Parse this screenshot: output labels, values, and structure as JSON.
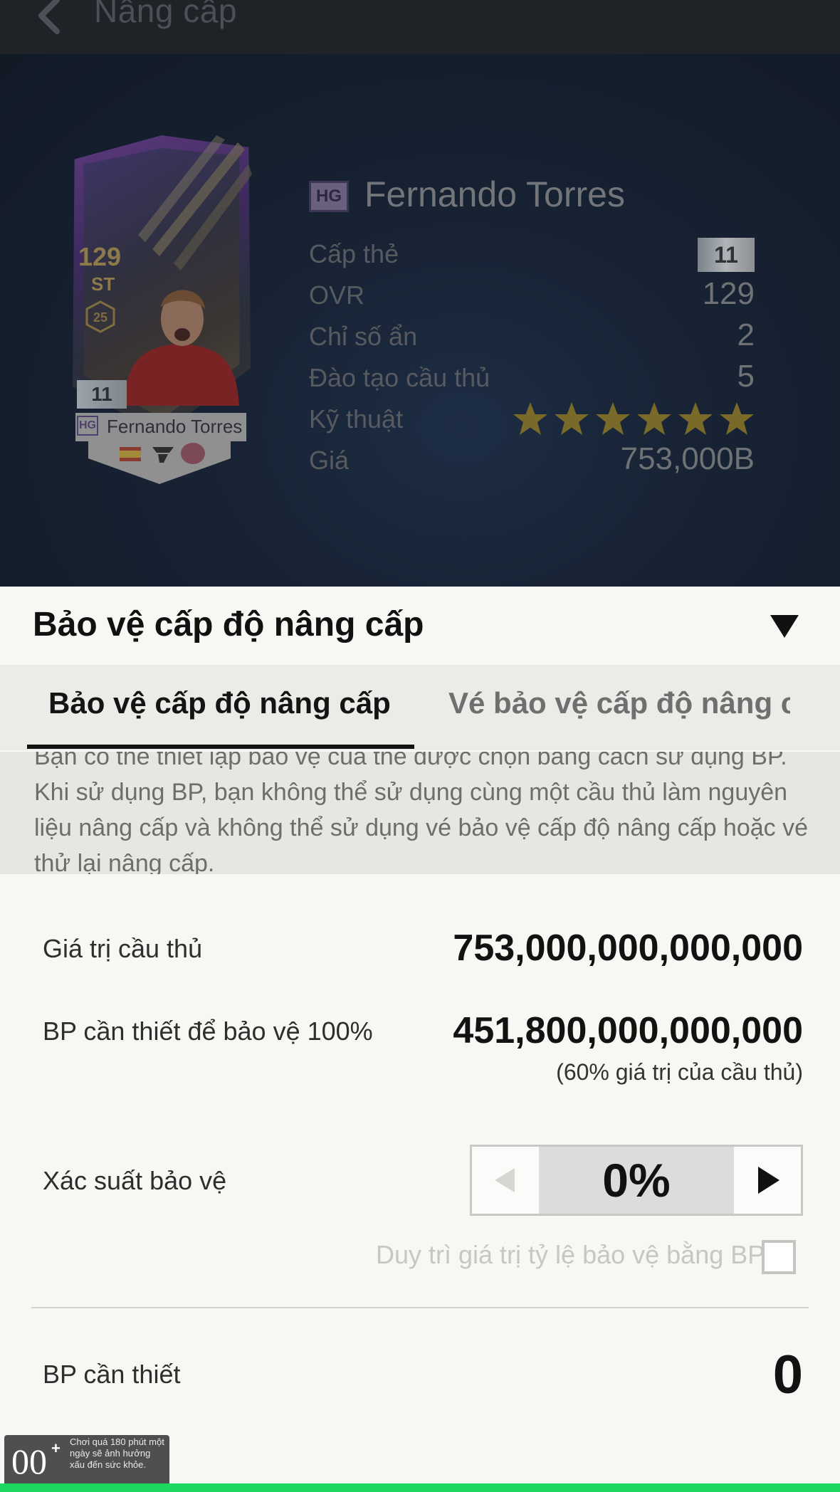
{
  "header": {
    "title": "Nâng cấp"
  },
  "player": {
    "name": "Fernando Torres",
    "season_badge": "HG",
    "card": {
      "ovr": "129",
      "position": "ST",
      "badge_number": "25",
      "level": "11",
      "name": "Fernando Torres",
      "season_badge": "HG"
    },
    "stats": [
      {
        "label": "Cấp thẻ",
        "value": "11"
      },
      {
        "label": "OVR",
        "value": "129"
      },
      {
        "label": "Chỉ số ẩn",
        "value": "2"
      },
      {
        "label": "Đào tạo cầu thủ",
        "value": "5"
      },
      {
        "label": "Kỹ thuật",
        "stars": 6
      },
      {
        "label": "Giá",
        "value": "753,000B"
      }
    ]
  },
  "sheet": {
    "title": "Bảo vệ cấp độ nâng cấp",
    "tabs": [
      {
        "label": "Bảo vệ cấp độ nâng cấp BP",
        "active": true
      },
      {
        "label": "Vé bảo vệ cấp độ nâng cấp",
        "active": false
      }
    ],
    "description": "Bạn có thể thiết lập bảo vệ của thẻ được chọn bằng cách sử dụng BP. Khi sử dụng BP, bạn không thể sử dụng cùng một cầu thủ làm nguyên liệu nâng cấp và không thể sử dụng vé bảo vệ cấp độ nâng cấp hoặc vé thử lại nâng cấp.",
    "player_value_label": "Giá trị cầu thủ",
    "player_value": "753,000,000,000,000",
    "bp_full_label": "BP cần thiết để bảo vệ 100%",
    "bp_full_value": "451,800,000,000,000",
    "bp_full_note": "(60% giá trị của cầu thủ)",
    "probability_label": "Xác suất bảo vệ",
    "probability_value": "0%",
    "keep_label": "Duy trì giá trị tỷ lệ bảo vệ bằng BP",
    "keep_checked": false,
    "bp_required_label": "BP cần thiết",
    "bp_required_value": "0"
  },
  "age_rating": {
    "number": "00",
    "plus": "+",
    "warning": "Chơi quá 180 phút một ngày sẽ ảnh hưởng xấu đến sức khỏe."
  },
  "colors": {
    "accent_green": "#1ed760",
    "star_gold": "#7a6a2a"
  }
}
